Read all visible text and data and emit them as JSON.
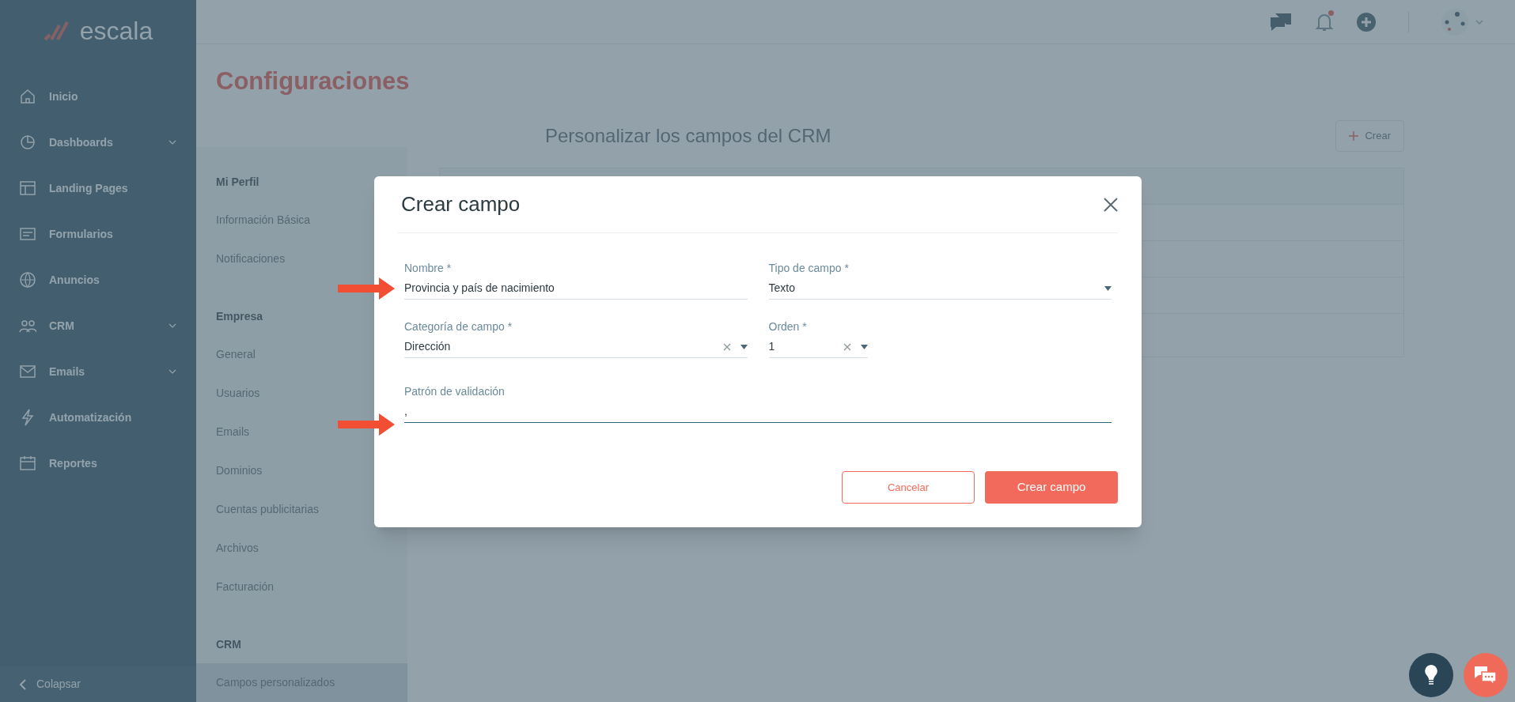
{
  "sidebar": {
    "logo": "escala",
    "items": [
      {
        "label": "Inicio",
        "expandable": false
      },
      {
        "label": "Dashboards",
        "expandable": true
      },
      {
        "label": "Landing Pages",
        "expandable": false
      },
      {
        "label": "Formularios",
        "expandable": false
      },
      {
        "label": "Anuncios",
        "expandable": false
      },
      {
        "label": "CRM",
        "expandable": true
      },
      {
        "label": "Emails",
        "expandable": true
      },
      {
        "label": "Automatización",
        "expandable": false
      },
      {
        "label": "Reportes",
        "expandable": false
      }
    ],
    "collapse": "Colapsar"
  },
  "header": {
    "notification_badge": true
  },
  "page": {
    "title": "Configuraciones"
  },
  "settings_nav": [
    {
      "heading": "Mi Perfil",
      "items": [
        {
          "label": "Información Básica",
          "selected": false
        },
        {
          "label": "Notificaciones",
          "selected": false
        }
      ]
    },
    {
      "heading": "Empresa",
      "items": [
        {
          "label": "General",
          "selected": false
        },
        {
          "label": "Usuarios",
          "selected": false
        },
        {
          "label": "Emails",
          "selected": false
        },
        {
          "label": "Dominios",
          "selected": false
        },
        {
          "label": "Cuentas publicitarias",
          "selected": false
        },
        {
          "label": "Archivos",
          "selected": false
        },
        {
          "label": "Facturación",
          "selected": false
        }
      ]
    },
    {
      "heading": "CRM",
      "items": [
        {
          "label": "Campos personalizados",
          "selected": true
        }
      ]
    }
  ],
  "content": {
    "title": "Personalizar los campos del CRM",
    "create_button": "Crear"
  },
  "modal": {
    "title": "Crear campo",
    "fields": [
      {
        "label": "Nombre *",
        "value": "Provincia y país de nacimiento",
        "kind": "text",
        "clearable": false,
        "focused": false,
        "arrow": true
      },
      {
        "label": "Tipo de campo *",
        "value": "Texto",
        "kind": "select",
        "clearable": false,
        "focused": false,
        "arrow": false
      },
      {
        "label": "Categoría de campo *",
        "value": "Dirección",
        "kind": "select",
        "clearable": true,
        "focused": false,
        "arrow": false
      },
      {
        "label": "Orden *",
        "value": "1",
        "kind": "select",
        "clearable": true,
        "focused": false,
        "arrow": false
      },
      {
        "label": "Patrón de validación",
        "value": ",",
        "kind": "text",
        "clearable": false,
        "focused": true,
        "arrow": true
      }
    ],
    "buttons": [
      {
        "label": "Cancelar",
        "kind": "secondary"
      },
      {
        "label": "Crear campo",
        "kind": "primary"
      }
    ]
  }
}
